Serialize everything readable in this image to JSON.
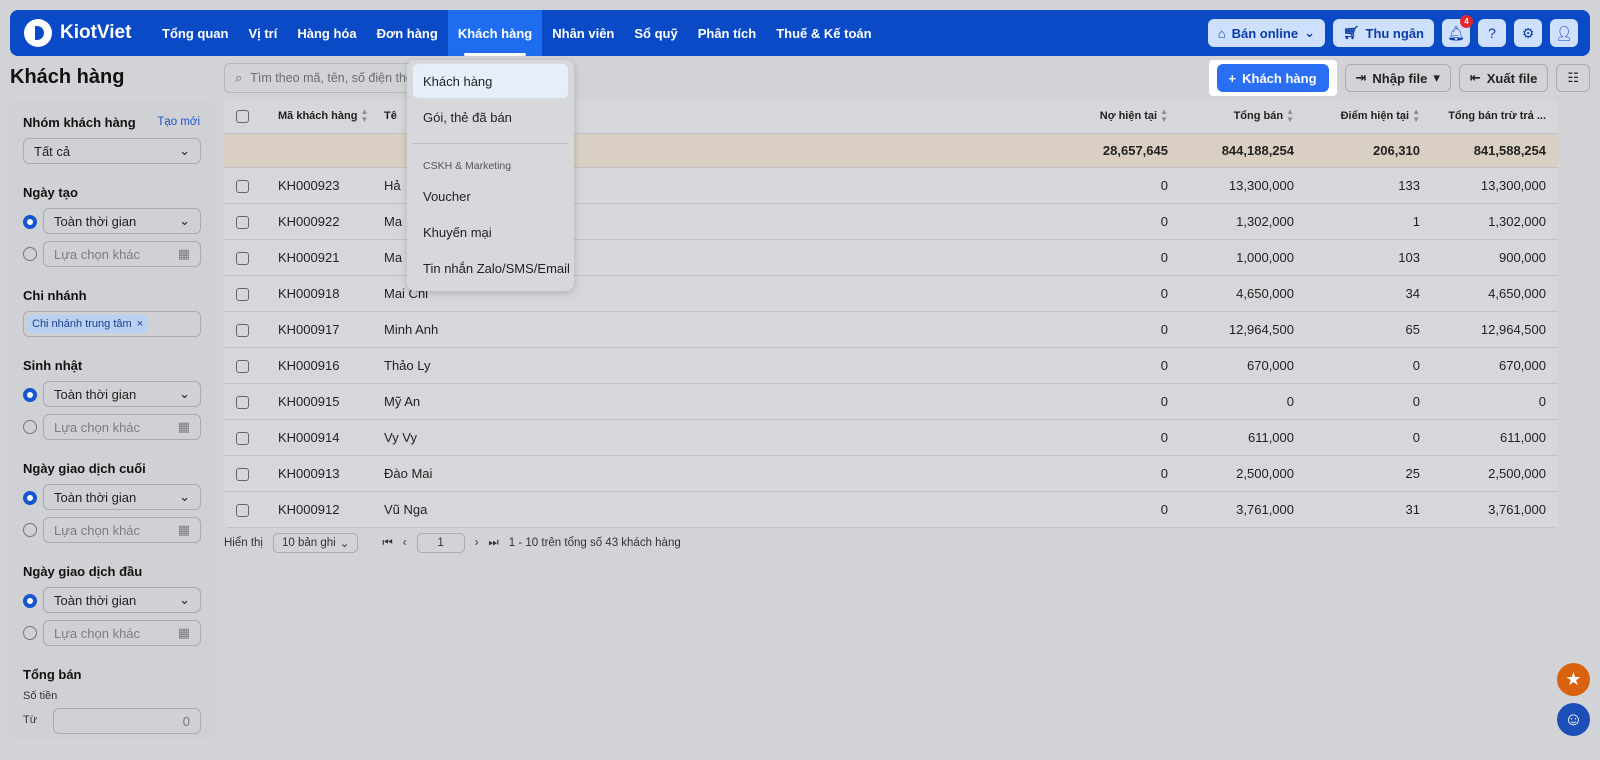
{
  "brand": "KiotViet",
  "nav": [
    "Tổng quan",
    "Vị trí",
    "Hàng hóa",
    "Đơn hàng",
    "Khách hàng",
    "Nhân viên",
    "Sổ quỹ",
    "Phân tích",
    "Thuế & Kế toán"
  ],
  "top_right": {
    "online": "Bán online",
    "cashier": "Thu ngân",
    "notif_count": "4"
  },
  "page_title": "Khách hàng",
  "search_placeholder": "Tìm theo mã, tên, số điện thoại",
  "actions": {
    "add": "Khách hàng",
    "import": "Nhập file",
    "export": "Xuất file"
  },
  "sidebar": {
    "group_title": "Nhóm khách hàng",
    "group_link": "Tạo mới",
    "group_value": "Tất cả",
    "created_title": "Ngày tạo",
    "all_time": "Toàn thời gian",
    "custom": "Lựa chọn khác",
    "branch_title": "Chi nhánh",
    "branch_tag": "Chi nhánh trung tâm",
    "birthday_title": "Sinh nhật",
    "last_tx_title": "Ngày giao dịch cuối",
    "first_tx_title": "Ngày giao dịch đầu",
    "total_title": "Tổng bán",
    "amount_label": "Số tiền",
    "from_label": "Từ",
    "from_value": "0"
  },
  "table": {
    "headers": {
      "code": "Mã khách hàng",
      "name": "Tê",
      "debt": "Nợ hiện tại",
      "total": "Tổng bán",
      "points": "Điểm hiện tại",
      "net": "Tổng bán trừ trả ..."
    },
    "summary": {
      "debt": "28,657,645",
      "total": "844,188,254",
      "points": "206,310",
      "net": "841,588,254"
    },
    "rows": [
      {
        "code": "KH000923",
        "name": "Hả",
        "debt": "0",
        "total": "13,300,000",
        "points": "133",
        "net": "13,300,000"
      },
      {
        "code": "KH000922",
        "name": "Ma",
        "debt": "0",
        "total": "1,302,000",
        "points": "1",
        "net": "1,302,000"
      },
      {
        "code": "KH000921",
        "name": "Ma",
        "debt": "0",
        "total": "1,000,000",
        "points": "103",
        "net": "900,000"
      },
      {
        "code": "KH000918",
        "name": "Mai Chi",
        "debt": "0",
        "total": "4,650,000",
        "points": "34",
        "net": "4,650,000"
      },
      {
        "code": "KH000917",
        "name": "Minh Anh",
        "debt": "0",
        "total": "12,964,500",
        "points": "65",
        "net": "12,964,500"
      },
      {
        "code": "KH000916",
        "name": "Thảo Ly",
        "debt": "0",
        "total": "670,000",
        "points": "0",
        "net": "670,000"
      },
      {
        "code": "KH000915",
        "name": "Mỹ An",
        "debt": "0",
        "total": "0",
        "points": "0",
        "net": "0"
      },
      {
        "code": "KH000914",
        "name": "Vy Vy",
        "debt": "0",
        "total": "611,000",
        "points": "0",
        "net": "611,000"
      },
      {
        "code": "KH000913",
        "name": "Đào Mai",
        "debt": "0",
        "total": "2,500,000",
        "points": "25",
        "net": "2,500,000"
      },
      {
        "code": "KH000912",
        "name": "Vũ Nga",
        "debt": "0",
        "total": "3,761,000",
        "points": "31",
        "net": "3,761,000"
      }
    ]
  },
  "pager": {
    "show_label": "Hiển thị",
    "per_page": "10 bản ghi",
    "page": "1",
    "summary": "1 - 10 trên tổng số 43 khách hàng"
  },
  "dropdown": {
    "items": [
      "Khách hàng",
      "Gói, thẻ đã bán"
    ],
    "section": "CSKH & Marketing",
    "items2": [
      "Voucher",
      "Khuyến mại",
      "Tin nhắn Zalo/SMS/Email"
    ]
  }
}
